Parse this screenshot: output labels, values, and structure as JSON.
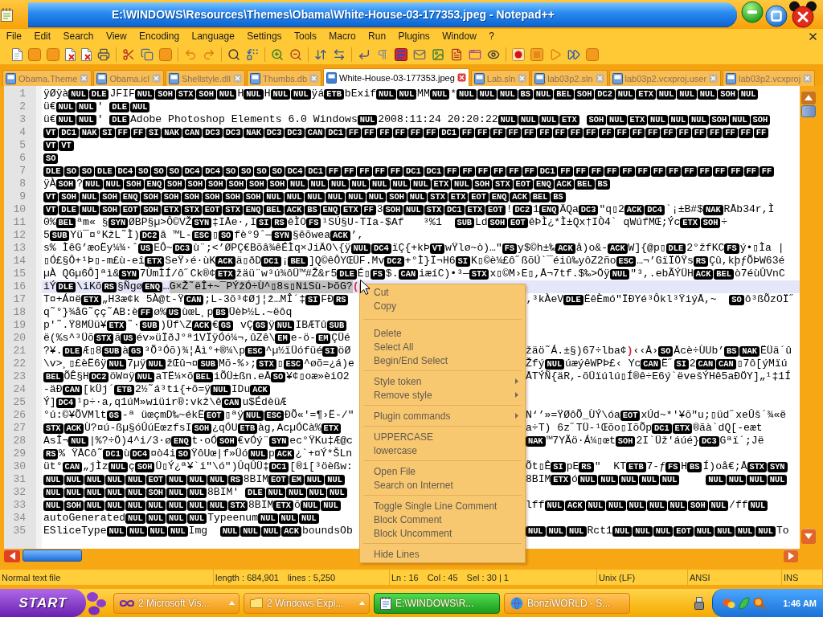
{
  "window": {
    "title": "E:\\WINDOWS\\Resources\\Themes\\Obama\\White-House-03-177353.jpeg - Notepad++"
  },
  "menu_bar": [
    "File",
    "Edit",
    "Search",
    "View",
    "Encoding",
    "Language",
    "Settings",
    "Tools",
    "Macro",
    "Run",
    "Plugins",
    "Window",
    "?"
  ],
  "tabs": [
    {
      "label": "Obama.Theme",
      "selected": false
    },
    {
      "label": "Obama.icl",
      "selected": false
    },
    {
      "label": "Shellstyle.dll",
      "selected": false
    },
    {
      "label": "Thumbs.db",
      "selected": false
    },
    {
      "label": "White-House-03-177353.jpeg",
      "selected": true
    },
    {
      "label": "Lab.sln",
      "selected": false
    },
    {
      "label": "lab03p2.sln",
      "selected": false
    },
    {
      "label": "lab03p2.vcxproj.user",
      "selected": false
    },
    {
      "label": "lab03p2.vcxproj",
      "selected": false
    }
  ],
  "editor": {
    "lines": [
      {
        "number": "1",
        "current": false,
        "segments": [
          {
            "kind": "text",
            "text": "ÿØÿà"
          },
          {
            "kind": "ctl",
            "text": "NUL DLE"
          },
          {
            "kind": "text",
            "text": "JFIF"
          },
          {
            "kind": "ctl",
            "text": "NUL SOH STX SOH NUL"
          },
          {
            "kind": "text",
            "text": "H"
          },
          {
            "kind": "ctl",
            "text": "NUL"
          },
          {
            "kind": "text",
            "text": "H"
          },
          {
            "kind": "ctl",
            "text": "NUL NUL"
          },
          {
            "kind": "text",
            "text": "ÿá"
          },
          {
            "kind": "ctl",
            "text": "ETB"
          },
          {
            "kind": "text",
            "text": "bExif"
          },
          {
            "kind": "ctl",
            "text": "NUL NUL"
          },
          {
            "kind": "text",
            "text": "MM"
          },
          {
            "kind": "ctl",
            "text": "NUL"
          },
          {
            "kind": "text",
            "text": "*"
          },
          {
            "kind": "ctl",
            "text": "NUL NUL NUL BS NUL BEL SOH DC2 NUL ETX NUL NUL NUL SOH NUL"
          }
        ]
      },
      {
        "number": "2",
        "current": false,
        "segments": [
          {
            "kind": "text",
            "text": "ü€"
          },
          {
            "kind": "ctl",
            "text": "NUL NUL"
          },
          {
            "kind": "text",
            "text": "' "
          },
          {
            "kind": "ctl",
            "text": "DLE NUL"
          }
        ]
      },
      {
        "number": "3",
        "current": false,
        "segments": [
          {
            "kind": "text",
            "text": "ü€"
          },
          {
            "kind": "ctl",
            "text": "NUL NUL"
          },
          {
            "kind": "text",
            "text": "' "
          },
          {
            "kind": "ctl",
            "text": "DLE"
          },
          {
            "kind": "text",
            "text": "Adobe Photoshop Elements 6.0 Windows"
          },
          {
            "kind": "ctl",
            "text": "NUL"
          },
          {
            "kind": "text",
            "text": "2008:11:24 20:20:22"
          },
          {
            "kind": "ctl",
            "text": "NUL NUL NUL ETX  SOH NUL ETX NUL NUL NUL SOH NUL SOH"
          }
        ]
      },
      {
        "number": "4",
        "current": false,
        "segments": [
          {
            "kind": "ctl",
            "text": "VT DC1 NAK SI FF FF SI NAK CAN DC3 DC3 NAK DC3 DC3 CAN DC1 FF FF FF FF FF FF DC1 FF FF FF FF FF FF FF FF FF FF FF FF FF FF FF FF FF FF FF FF"
          }
        ]
      },
      {
        "number": "5",
        "current": false,
        "segments": [
          {
            "kind": "ctl",
            "text": "VT VT"
          }
        ]
      },
      {
        "number": "6",
        "current": false,
        "segments": [
          {
            "kind": "ctl",
            "text": "SO"
          }
        ]
      },
      {
        "number": "7",
        "current": false,
        "segments": [
          {
            "kind": "ctl",
            "text": "DLE SO SO DLE DC4 SO SO SO DC4 DC4 SO SO SO SO DC4 DC1 FF FF FF FF FF DC1 DC1 FF FF FF FF FF FF DC1 FF FF FF FF FF FF FF FF FF FF FF FF FF FF"
          }
        ]
      },
      {
        "number": "8",
        "current": false,
        "segments": [
          {
            "kind": "text",
            "text": "ÿÀ"
          },
          {
            "kind": "ctl",
            "text": "SOH"
          },
          {
            "kind": "text",
            "text": "?"
          },
          {
            "kind": "ctl",
            "text": "NUL NUL SOH ENQ SOH SOH SOH SOH SOH SOH NUL NUL NUL NUL NUL NUL NUL ETX NUL SOH STX EOT ENQ ACK BEL BS"
          }
        ]
      },
      {
        "number": "9",
        "current": false,
        "segments": [
          {
            "kind": "ctl",
            "text": "VT SOH NUL SOH ENQ SOH SOH SOH SOH SOH SOH NUL NUL NUL NUL NUL NUL SOH NUL STX ETX EOT ENQ ACK BEL BS"
          }
        ]
      },
      {
        "number": "10",
        "current": false,
        "segments": [
          {
            "kind": "ctl",
            "text": "VT DLE NUL SOH EOT SOH ETX STX EOT STX ENQ BEL ACK BS ENQ ETX FF"
          },
          {
            "kind": "text",
            "text": "3"
          },
          {
            "kind": "ctl",
            "text": "SOH NUL STX DC1 ETX EOT"
          },
          {
            "kind": "text",
            "text": "!"
          },
          {
            "kind": "ctl",
            "text": "DC2"
          },
          {
            "kind": "text",
            "text": "1"
          },
          {
            "kind": "ctl",
            "text": "ENQ"
          },
          {
            "kind": "text",
            "text": "ÄQa"
          },
          {
            "kind": "ctl",
            "text": "DC3"
          },
          {
            "kind": "text",
            "text": "\"q▯2"
          },
          {
            "kind": "ctl",
            "text": "ACK DC4"
          },
          {
            "kind": "text",
            "text": "`¡±B#$"
          },
          {
            "kind": "ctl",
            "text": "NAK"
          },
          {
            "kind": "text",
            "text": "RÅb34r,Ì"
          }
        ]
      },
      {
        "number": "11",
        "current": false,
        "segments": [
          {
            "kind": "text",
            "text": "0%"
          },
          {
            "kind": "ctl",
            "text": "BEL"
          },
          {
            "kind": "text",
            "text": "ªm« §"
          },
          {
            "kind": "ctl",
            "text": "SYN"
          },
          {
            "kind": "text",
            "text": "ØBP§µ>Ô©VŽ"
          },
          {
            "kind": "ctl",
            "text": "SYN"
          },
          {
            "kind": "text",
            "text": "‡IÅe·,I"
          },
          {
            "kind": "ctl",
            "text": "SI RS"
          },
          {
            "kind": "text",
            "text": "êÌO"
          },
          {
            "kind": "ctl",
            "text": "FS"
          },
          {
            "kind": "text",
            "text": "¹SÚ§U-TIa-$Af   ³%1  "
          },
          {
            "kind": "ctl",
            "text": "SUB"
          },
          {
            "kind": "text",
            "text": "Ld"
          },
          {
            "kind": "ctl",
            "text": "SOH EOT"
          },
          {
            "kind": "text",
            "text": "êÞÌ¿*Ì±Qx†IÒ4` qWúfMŒ;Ýc"
          },
          {
            "kind": "ctl",
            "text": "ETX SOH"
          },
          {
            "kind": "text",
            "text": "÷"
          }
        ]
      },
      {
        "number": "12",
        "current": false,
        "segments": [
          {
            "kind": "text",
            "text": "5"
          },
          {
            "kind": "ctl",
            "text": "SUB"
          },
          {
            "kind": "text",
            "text": "Yü¯¤°KžL˜Ì)"
          },
          {
            "kind": "ctl",
            "text": "DC2"
          },
          {
            "kind": "text",
            "text": "â ™L-"
          },
          {
            "kind": "ctl",
            "text": "ESC"
          },
          {
            "kind": "text",
            "text": "▯"
          },
          {
            "kind": "ctl",
            "text": "SO"
          },
          {
            "kind": "text",
            "text": "fè°9ˆ—"
          },
          {
            "kind": "ctl",
            "text": "SYN"
          },
          {
            "kind": "text",
            "text": "§êõwea"
          },
          {
            "kind": "ctl",
            "text": "ACK"
          },
          {
            "kind": "text",
            "text": "’,"
          }
        ]
      },
      {
        "number": "13",
        "current": false,
        "segments": [
          {
            "kind": "text",
            "text": "s% ÌêG’æoËy¼¾·ˆ"
          },
          {
            "kind": "ctl",
            "text": "US"
          },
          {
            "kind": "text",
            "text": "EÔ~"
          },
          {
            "kind": "ctl",
            "text": "DC3"
          },
          {
            "kind": "text",
            "text": "ù¨;<’ØPÇ€Bõâ¾êÉÌq×JiÄO\\{ÿ"
          },
          {
            "kind": "ctl",
            "text": "NUL DC4"
          },
          {
            "kind": "text",
            "text": "ïÇ{+kÞ"
          },
          {
            "kind": "ctl",
            "text": "VT"
          },
          {
            "kind": "text",
            "text": "wŸlø~ò)…\""
          },
          {
            "kind": "ctl",
            "text": "FS"
          },
          {
            "kind": "text",
            "text": "y$©h±‰"
          },
          {
            "kind": "ctl",
            "text": "ACK"
          },
          {
            "kind": "text",
            "text": "å)o&-"
          },
          {
            "kind": "ctl",
            "text": "ACK"
          },
          {
            "kind": "text",
            "text": "W]{@p▯"
          },
          {
            "kind": "ctl",
            "text": "DLE"
          },
          {
            "kind": "text",
            "text": "2°žfKC"
          },
          {
            "kind": "ctl",
            "text": "FS"
          },
          {
            "kind": "text",
            "text": "ý•▯Ìa |"
          }
        ]
      },
      {
        "number": "14",
        "current": false,
        "segments": [
          {
            "kind": "text",
            "text": "▯Ó£§Ô+¹Þ▯-m£ù-eî"
          },
          {
            "kind": "ctl",
            "text": "ETX"
          },
          {
            "kind": "text",
            "text": "SeŸ›é·ùK"
          },
          {
            "kind": "ctl",
            "text": "ACK"
          },
          {
            "kind": "text",
            "text": "ä▯ðD"
          },
          {
            "kind": "ctl",
            "text": "DC1"
          },
          {
            "kind": "text",
            "text": "¡"
          },
          {
            "kind": "ctl",
            "text": "BEL"
          },
          {
            "kind": "text",
            "text": "]Q©êÔYŒÜF.Mv"
          },
          {
            "kind": "ctl",
            "text": "DC2"
          },
          {
            "kind": "text",
            "text": "+°Ì}Ï¬H6"
          },
          {
            "kind": "ctl",
            "text": "SI"
          },
          {
            "kind": "text",
            "text": "K▯©è¼£ô˝ßõÚ`¯éiû‰yôZ2ño"
          },
          {
            "kind": "ctl",
            "text": "ESC"
          },
          {
            "kind": "text",
            "text": "…¬’GïÏÖŸs"
          },
          {
            "kind": "ctl",
            "text": "RS"
          },
          {
            "kind": "text",
            "text": "Çû,kþƒÕÞW63é"
          }
        ]
      },
      {
        "number": "15",
        "current": false,
        "segments": [
          {
            "kind": "text",
            "text": "µÀ QGµ6Ô]ªì&"
          },
          {
            "kind": "ctl",
            "text": "SYN"
          },
          {
            "kind": "text",
            "text": "7ÙmÌÍ/ô˝Ck®¢"
          },
          {
            "kind": "ctl",
            "text": "ETX"
          },
          {
            "kind": "text",
            "text": "žäü¨w³ú¾ôÜ™#Ž&r5"
          },
          {
            "kind": "ctl",
            "text": "DLE"
          },
          {
            "kind": "text",
            "text": "É▯"
          },
          {
            "kind": "ctl",
            "text": "FS"
          },
          {
            "kind": "text",
            "text": "$."
          },
          {
            "kind": "ctl",
            "text": "CAN"
          },
          {
            "kind": "text",
            "text": "iæíC)•³—"
          },
          {
            "kind": "ctl",
            "text": "STX"
          },
          {
            "kind": "text",
            "text": "x▯©M›E▯,Å¬7tf.$‰>Öÿ"
          },
          {
            "kind": "ctl",
            "text": "NUL"
          },
          {
            "kind": "text",
            "text": "\"³,.ebÃÝÜH"
          },
          {
            "kind": "ctl",
            "text": "ACK BEL"
          },
          {
            "kind": "text",
            "text": "ò7éùÛVnC"
          }
        ]
      },
      {
        "number": "16",
        "current": true,
        "segments": [
          {
            "kind": "text",
            "text": "iÝ"
          },
          {
            "kind": "ctl",
            "text": "DLE"
          },
          {
            "kind": "text",
            "text": "\\iKõ"
          },
          {
            "kind": "ctl",
            "text": "RS"
          },
          {
            "kind": "text",
            "text": "§Ñgø"
          },
          {
            "kind": "ctl",
            "text": "ENQ"
          },
          {
            "kind": "text",
            "text": "…"
          },
          {
            "kind": "sel",
            "text": "G×Ž˜ëÎ+~¯PÝžÓ÷Ù^▯8s▯NiSù-ÞõG?"
          },
          {
            "kind": "brace",
            "text": "("
          }
        ]
      },
      {
        "number": "17",
        "current": false,
        "segments": [
          {
            "kind": "text",
            "text": "T¤+Á¤ë"
          },
          {
            "kind": "ctl",
            "text": "ETX"
          },
          {
            "kind": "text",
            "text": "„H3æ¢k 5À@t-Ÿ"
          },
          {
            "kind": "ctl",
            "text": "CAN"
          },
          {
            "kind": "text",
            "text": ";L-3õ³¢Øj¦ž…MÎ´‡"
          },
          {
            "kind": "ctl",
            "text": "SI"
          },
          {
            "kind": "text",
            "text": "FÐ"
          },
          {
            "kind": "ctl",
            "text": "RS"
          }
        ],
        "after_menu": [
          {
            "kind": "text",
            "text": "‚³kÀeV"
          },
          {
            "kind": "ctl",
            "text": "DLE"
          },
          {
            "kind": "text",
            "text": "ËêÈmó\"ÏÐYé³Ôkl³ŸiýÅ,~  "
          },
          {
            "kind": "ctl",
            "text": "SO"
          },
          {
            "kind": "text",
            "text": "ô³ßÕzOÏ˝"
          }
        ]
      },
      {
        "number": "18",
        "current": false,
        "segments": [
          {
            "kind": "text",
            "text": "q˜°}¾åG˜çç˜AB:è"
          },
          {
            "kind": "ctl",
            "text": "FF"
          },
          {
            "kind": "text",
            "text": "ø%"
          },
          {
            "kind": "ctl",
            "text": "US"
          },
          {
            "kind": "text",
            "text": "ùœL¸p"
          },
          {
            "kind": "ctl",
            "text": "BS"
          },
          {
            "kind": "text",
            "text": "ÜèÞ½L.~ëôq"
          }
        ]
      },
      {
        "number": "19",
        "current": false,
        "segments": [
          {
            "kind": "text",
            "text": "p'˜.Ÿ8MÜü¥"
          },
          {
            "kind": "ctl",
            "text": "ETX"
          },
          {
            "kind": "text",
            "text": "˜·"
          },
          {
            "kind": "ctl",
            "text": "SUB"
          },
          {
            "kind": "text",
            "text": ")Üf\\Z"
          },
          {
            "kind": "ctl",
            "text": "ACK"
          },
          {
            "kind": "text",
            "text": "€"
          },
          {
            "kind": "ctl",
            "text": "GS"
          },
          {
            "kind": "text",
            "text": " vÇ"
          },
          {
            "kind": "ctl",
            "text": "GS"
          },
          {
            "kind": "text",
            "text": "ÿ"
          },
          {
            "kind": "ctl",
            "text": "NUL"
          },
          {
            "kind": "text",
            "text": "IBÆTû"
          },
          {
            "kind": "ctl",
            "text": "SUB"
          }
        ]
      },
      {
        "number": "20",
        "current": false,
        "segments": [
          {
            "kind": "text",
            "text": "ë(%s^³Üõ"
          },
          {
            "kind": "ctl",
            "text": "STX"
          },
          {
            "kind": "text",
            "text": "ã"
          },
          {
            "kind": "ctl",
            "text": "US"
          },
          {
            "kind": "text",
            "text": "év»üÏðJ°ª1VÏÿÓó¼¬,ûZê\\"
          },
          {
            "kind": "ctl",
            "text": "EM"
          },
          {
            "kind": "text",
            "text": "e-ö-"
          },
          {
            "kind": "ctl",
            "text": "EM"
          },
          {
            "kind": "text",
            "text": "ÇÜé"
          }
        ]
      },
      {
        "number": "21",
        "current": false,
        "segments": [
          {
            "kind": "text",
            "text": "?¥."
          },
          {
            "kind": "ctl",
            "text": "DLE"
          },
          {
            "kind": "text",
            "text": "Æ▯8"
          },
          {
            "kind": "ctl",
            "text": "SUB"
          },
          {
            "kind": "text",
            "text": "à"
          },
          {
            "kind": "ctl",
            "text": "GS"
          },
          {
            "kind": "text",
            "text": "³Õ³Óõ)¾¦Åì°+®¼\\p"
          },
          {
            "kind": "ctl",
            "text": "ESC"
          },
          {
            "kind": "text",
            "text": "^µ½ïÜófüé"
          },
          {
            "kind": "ctl",
            "text": "SI"
          },
          {
            "kind": "text",
            "text": "öØ"
          }
        ],
        "after_menu": [
          {
            "kind": "text",
            "text": "žäö˜Á.±§)67÷lba¢"
          },
          {
            "kind": "brace",
            "text": ")"
          },
          {
            "kind": "text",
            "text": "‹‹Å›"
          },
          {
            "kind": "ctl",
            "text": "SO"
          },
          {
            "kind": "text",
            "text": "Åcè÷ÙUb’"
          },
          {
            "kind": "ctl",
            "text": "BS NAK"
          },
          {
            "kind": "text",
            "text": "ËÜä´û"
          }
        ]
      },
      {
        "number": "22",
        "current": false,
        "segments": [
          {
            "kind": "text",
            "text": "\\v>¸▯£èË6ÿ"
          },
          {
            "kind": "ctl",
            "text": "NUL"
          },
          {
            "kind": "text",
            "text": "7µÿ"
          },
          {
            "kind": "ctl",
            "text": "NUL"
          },
          {
            "kind": "text",
            "text": "žŒû¬¤"
          },
          {
            "kind": "ctl",
            "text": "SUB"
          },
          {
            "kind": "text",
            "text": "Mõ-%›;"
          },
          {
            "kind": "ctl",
            "text": "STX"
          },
          {
            "kind": "text",
            "text": "▯"
          },
          {
            "kind": "ctl",
            "text": "ESC"
          },
          {
            "kind": "text",
            "text": "^øõ=¿á)e"
          }
        ],
        "after_menu": [
          {
            "kind": "text",
            "text": "Žfý"
          },
          {
            "kind": "ctl",
            "text": "NUL"
          },
          {
            "kind": "text",
            "text": "úæýêWPÞ£‹ Yc"
          },
          {
            "kind": "ctl",
            "text": "CAN"
          },
          {
            "kind": "text",
            "text": "Ë˝"
          },
          {
            "kind": "ctl",
            "text": "SI"
          },
          {
            "kind": "text",
            "text": "2"
          },
          {
            "kind": "ctl",
            "text": "CAN CAN"
          },
          {
            "kind": "text",
            "text": "▯7ô[ýMïú"
          }
        ]
      },
      {
        "number": "23",
        "current": false,
        "segments": [
          {
            "kind": "ctl",
            "text": "BEL"
          },
          {
            "kind": "text",
            "text": "ÕÊ§H"
          },
          {
            "kind": "ctl",
            "text": "DC2"
          },
          {
            "kind": "text",
            "text": "öW¤ÿ"
          },
          {
            "kind": "ctl",
            "text": "NUL"
          },
          {
            "kind": "text",
            "text": "aTË¼×õ"
          },
          {
            "kind": "ctl",
            "text": "BEL"
          },
          {
            "kind": "text",
            "text": "iÕÜ±ßn.eÅ"
          },
          {
            "kind": "ctl",
            "text": "SO"
          },
          {
            "kind": "text",
            "text": "¥¢▯oæ»èiO2"
          }
        ],
        "after_menu": [
          {
            "kind": "text",
            "text": "ÅTÝÑ{äR,-õÜïúlú▯Í®ê÷E6ý`ëvešÝHê5aÐÖY]„¹‡1Í"
          }
        ]
      },
      {
        "number": "24",
        "current": false,
        "segments": [
          {
            "kind": "text",
            "text": "-äÐ"
          },
          {
            "kind": "ctl",
            "text": "CAN"
          },
          {
            "kind": "text",
            "text": "[kÜj´"
          },
          {
            "kind": "ctl",
            "text": "ETB"
          },
          {
            "kind": "text",
            "text": "2½˜á³ti{+õ=ÿ"
          },
          {
            "kind": "ctl",
            "text": "NUL"
          },
          {
            "kind": "text",
            "text": "IDu"
          },
          {
            "kind": "ctl",
            "text": "ACK"
          }
        ]
      },
      {
        "number": "25",
        "current": false,
        "segments": [
          {
            "kind": "text",
            "text": "Ý]"
          },
          {
            "kind": "ctl",
            "text": "DC4"
          },
          {
            "kind": "text",
            "text": "¹p÷·a,q1úM»wiüir®:vkž\\ê"
          },
          {
            "kind": "ctl",
            "text": "CAN"
          },
          {
            "kind": "text",
            "text": "u$ÉdèüÆ"
          }
        ]
      },
      {
        "number": "26",
        "current": false,
        "segments": [
          {
            "kind": "text",
            "text": "°ú:©¥ÕVMlt"
          },
          {
            "kind": "ctl",
            "text": "GS"
          },
          {
            "kind": "text",
            "text": "-ª üœçmD‰~ékË"
          },
          {
            "kind": "ctl",
            "text": "EOT"
          },
          {
            "kind": "text",
            "text": "▯ªÿ"
          },
          {
            "kind": "ctl",
            "text": "NUL ESC"
          },
          {
            "kind": "text",
            "text": "ÐÕ«'=¶›Ë-/\""
          }
        ],
        "after_menu": [
          {
            "kind": "text",
            "text": "N‘’»=ŸØôÕ_ÙÝ\\óa"
          },
          {
            "kind": "ctl",
            "text": "EOT"
          },
          {
            "kind": "text",
            "text": "xÚd~*'¥õ\"u;▯üd˝xeÛš´¾«ë"
          }
        ]
      },
      {
        "number": "27",
        "current": false,
        "segments": [
          {
            "kind": "ctl",
            "text": "STX ACK"
          },
          {
            "kind": "text",
            "text": "Ù?¤ú-ßµ§óÛúEœzfsI"
          },
          {
            "kind": "ctl",
            "text": "SOH"
          },
          {
            "kind": "text",
            "text": "¿qÓU"
          },
          {
            "kind": "ctl",
            "text": "ETB"
          },
          {
            "kind": "text",
            "text": "àg,AcµÓCà%"
          },
          {
            "kind": "ctl",
            "text": "ETX"
          }
        ],
        "after_menu": [
          {
            "kind": "text",
            "text": "a÷T) 6z˝TÜ-¹Œõo▯IõÕp"
          },
          {
            "kind": "ctl",
            "text": "DC1 ETX"
          },
          {
            "kind": "text",
            "text": "®ãà`dQ[-eæt"
          }
        ]
      },
      {
        "number": "28",
        "current": false,
        "segments": [
          {
            "kind": "text",
            "text": "AsÎ¬"
          },
          {
            "kind": "ctl",
            "text": "NUL"
          },
          {
            "kind": "text",
            "text": "|%?÷Ö)4^i/3·ø"
          },
          {
            "kind": "ctl",
            "text": "ENQ"
          },
          {
            "kind": "text",
            "text": "t·oÓ"
          },
          {
            "kind": "ctl",
            "text": "SOH"
          },
          {
            "kind": "text",
            "text": "€vÓý¨"
          },
          {
            "kind": "ctl",
            "text": "SYN"
          },
          {
            "kind": "text",
            "text": "ec°ŸKu‡Æ@c"
          }
        ],
        "after_menu": [
          {
            "kind": "ctl",
            "text": "NAK"
          },
          {
            "kind": "text",
            "text": "™7YÃö·Á¼▯œt"
          },
          {
            "kind": "ctl",
            "text": "SOH"
          },
          {
            "kind": "text",
            "text": "2I`Üž'áúé}"
          },
          {
            "kind": "ctl",
            "text": "DC3"
          },
          {
            "kind": "text",
            "text": "Gªï´;Jë"
          }
        ]
      },
      {
        "number": "29",
        "current": false,
        "segments": [
          {
            "kind": "ctl",
            "text": "RS"
          },
          {
            "kind": "text",
            "text": "% ŸÅCô˜"
          },
          {
            "kind": "ctl",
            "text": "DC1"
          },
          {
            "kind": "text",
            "text": "ù"
          },
          {
            "kind": "ctl",
            "text": "DC4"
          },
          {
            "kind": "text",
            "text": "¤ò4i"
          },
          {
            "kind": "ctl",
            "text": "SO"
          },
          {
            "kind": "text",
            "text": "ŸôUœ|f»Üó"
          },
          {
            "kind": "ctl",
            "text": "NUL"
          },
          {
            "kind": "text",
            "text": "p"
          },
          {
            "kind": "ctl",
            "text": "ACK"
          },
          {
            "kind": "text",
            "text": "¿`+¤Ý*ŠLn"
          }
        ]
      },
      {
        "number": "30",
        "current": false,
        "segments": [
          {
            "kind": "text",
            "text": "üt°"
          },
          {
            "kind": "ctl",
            "text": "CAN"
          },
          {
            "kind": "text",
            "text": "„jÌz"
          },
          {
            "kind": "ctl",
            "text": "NUL"
          },
          {
            "kind": "text",
            "text": "ç"
          },
          {
            "kind": "ctl",
            "text": "SOH"
          },
          {
            "kind": "text",
            "text": "Ü▯Ý¿ª¥`i\"\\ó\")ÛqÛÜ‡"
          },
          {
            "kind": "ctl",
            "text": "DC1"
          },
          {
            "kind": "text",
            "text": "[®i[³öèßw:"
          }
        ],
        "after_menu": [
          {
            "kind": "text",
            "text": "Õt▯Ê"
          },
          {
            "kind": "ctl",
            "text": "SI"
          },
          {
            "kind": "text",
            "text": "pE"
          },
          {
            "kind": "ctl",
            "text": "RS"
          },
          {
            "kind": "text",
            "text": "\"  KT"
          },
          {
            "kind": "ctl",
            "text": "ETB"
          },
          {
            "kind": "text",
            "text": "7-ƒ"
          },
          {
            "kind": "ctl",
            "text": "FS"
          },
          {
            "kind": "text",
            "text": "H"
          },
          {
            "kind": "ctl",
            "text": "BS"
          },
          {
            "kind": "text",
            "text": "Í)oå€;Å"
          },
          {
            "kind": "ctl",
            "text": "STX SYN"
          }
        ]
      },
      {
        "number": "31",
        "current": false,
        "segments": [
          {
            "kind": "ctl",
            "text": "NUL NUL NUL NUL NUL EOT NUL NUL NUL RS"
          },
          {
            "kind": "text",
            "text": "8BIM"
          },
          {
            "kind": "ctl",
            "text": "EOT EM NUL NUL"
          }
        ],
        "after_menu": [
          {
            "kind": "text",
            "text": "8BIM"
          },
          {
            "kind": "ctl",
            "text": "ETX"
          },
          {
            "kind": "text",
            "text": "ó"
          },
          {
            "kind": "ctl",
            "text": "NUL NUL NUL NUL NUL     NUL NUL NUL NUL"
          }
        ]
      },
      {
        "number": "32",
        "current": false,
        "segments": [
          {
            "kind": "ctl",
            "text": "NUL NUL NUL NUL NUL SOH NUL NUL"
          },
          {
            "kind": "text",
            "text": "8BIM' "
          },
          {
            "kind": "ctl",
            "text": "DLE NUL NUL NUL NUL"
          }
        ]
      },
      {
        "number": "33",
        "current": false,
        "segments": [
          {
            "kind": "ctl",
            "text": "NUL SOH NUL NUL NUL NUL NUL NUL NUL STX"
          },
          {
            "kind": "text",
            "text": "8BIM"
          },
          {
            "kind": "ctl",
            "text": "ETX"
          },
          {
            "kind": "text",
            "text": "õ"
          },
          {
            "kind": "ctl",
            "text": "NUL NUL"
          }
        ],
        "after_menu": [
          {
            "kind": "text",
            "text": "lff"
          },
          {
            "kind": "ctl",
            "text": "NUL ACK NUL NUL NUL NUL NUL SOH NUL"
          },
          {
            "kind": "text",
            "text": "/ff"
          },
          {
            "kind": "ctl",
            "text": "NUL"
          }
        ]
      },
      {
        "number": "34",
        "current": false,
        "segments": [
          {
            "kind": "text",
            "text": "autoGenerated"
          },
          {
            "kind": "ctl",
            "text": "NUL NUL NUL NUL"
          },
          {
            "kind": "text",
            "text": "Typeenum"
          },
          {
            "kind": "ctl",
            "text": "NUL NUL NUL"
          }
        ]
      },
      {
        "number": "35",
        "current": false,
        "segments": [
          {
            "kind": "text",
            "text": "ESliceType"
          },
          {
            "kind": "ctl",
            "text": "NUL NUL NUL NUL"
          },
          {
            "kind": "text",
            "text": "Img  "
          },
          {
            "kind": "ctl",
            "text": "NUL NUL NUL ACK"
          },
          {
            "kind": "text",
            "text": "boundsOb"
          }
        ],
        "after_menu": [
          {
            "kind": "ctl",
            "text": "NUL NUL NUL"
          },
          {
            "kind": "text",
            "text": "Rct1"
          },
          {
            "kind": "ctl",
            "text": "NUL NUL NUL EOT NUL NUL NUL NUL"
          },
          {
            "kind": "text",
            "text": "To"
          }
        ]
      }
    ]
  },
  "context_menu": {
    "groups": [
      [
        {
          "label": "Cut",
          "submenu": false
        },
        {
          "label": "Copy",
          "submenu": false
        }
      ],
      [
        {
          "label": "Delete",
          "submenu": false
        },
        {
          "label": "Select All",
          "submenu": false
        },
        {
          "label": "Begin/End Select",
          "submenu": false
        }
      ],
      [
        {
          "label": "Style token",
          "submenu": true
        },
        {
          "label": "Remove style",
          "submenu": true
        }
      ],
      [
        {
          "label": "Plugin commands",
          "submenu": true
        }
      ],
      [
        {
          "label": "UPPERCASE",
          "submenu": false
        },
        {
          "label": "lowercase",
          "submenu": false
        }
      ],
      [
        {
          "label": "Open File",
          "submenu": false
        },
        {
          "label": "Search on Internet",
          "submenu": false
        }
      ],
      [
        {
          "label": "Toggle Single Line Comment",
          "submenu": false
        },
        {
          "label": "Block Comment",
          "submenu": false
        },
        {
          "label": "Block Uncomment",
          "submenu": false
        }
      ],
      [
        {
          "label": "Hide Lines",
          "submenu": false
        }
      ]
    ]
  },
  "status_bar": {
    "file_type": "Normal text file",
    "length": "length : 684,901",
    "lines": "lines : 5,250",
    "line": "Ln : 16",
    "column": "Col : 45",
    "selection": "Sel : 30 | 1",
    "eol": "Unix (LF)",
    "encoding": "ANSI",
    "mode": "INS"
  },
  "taskbar": {
    "start": "START",
    "tasks": [
      {
        "label": "2 Microsoft Vis...",
        "selected": false,
        "grouped": true
      },
      {
        "label": "2 Windows Expl...",
        "selected": false,
        "grouped": true
      },
      {
        "label": "E:\\WINDOWS\\R...",
        "selected": true,
        "grouped": false
      },
      {
        "label": "BonziWORLD - S...",
        "selected": false,
        "grouped": false
      }
    ],
    "clock": "1:46 AM"
  }
}
